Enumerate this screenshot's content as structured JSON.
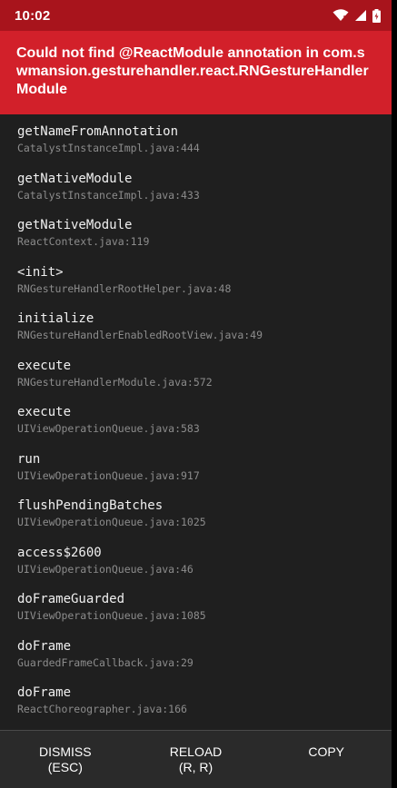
{
  "status_bar": {
    "time": "10:02",
    "icons": [
      "wifi-icon",
      "signal-icon",
      "battery-icon"
    ]
  },
  "error": {
    "message": "Could not find @ReactModule annotation in com.swmansion.gesturehandler.react.RNGestureHandlerModule"
  },
  "stack": [
    {
      "method": "getNameFromAnnotation",
      "file": "CatalystInstanceImpl.java:444"
    },
    {
      "method": "getNativeModule",
      "file": "CatalystInstanceImpl.java:433"
    },
    {
      "method": "getNativeModule",
      "file": "ReactContext.java:119"
    },
    {
      "method": "<init>",
      "file": "RNGestureHandlerRootHelper.java:48"
    },
    {
      "method": "initialize",
      "file": "RNGestureHandlerEnabledRootView.java:49"
    },
    {
      "method": "execute",
      "file": "RNGestureHandlerModule.java:572"
    },
    {
      "method": "execute",
      "file": "UIViewOperationQueue.java:583"
    },
    {
      "method": "run",
      "file": "UIViewOperationQueue.java:917"
    },
    {
      "method": "flushPendingBatches",
      "file": "UIViewOperationQueue.java:1025"
    },
    {
      "method": "access$2600",
      "file": "UIViewOperationQueue.java:46"
    },
    {
      "method": "doFrameGuarded",
      "file": "UIViewOperationQueue.java:1085"
    },
    {
      "method": "doFrame",
      "file": "GuardedFrameCallback.java:29"
    },
    {
      "method": "doFrame",
      "file": "ReactChoreographer.java:166"
    }
  ],
  "footer": {
    "dismiss": {
      "label": "DISMISS",
      "hint": "(ESC)"
    },
    "reload": {
      "label": "RELOAD",
      "hint": "(R, R)"
    },
    "copy": {
      "label": "COPY"
    }
  },
  "colors": {
    "header_red": "#d2202a",
    "statusbar_red": "#a8141c",
    "background": "#1f1f1f",
    "footer": "#2a2a2a"
  }
}
